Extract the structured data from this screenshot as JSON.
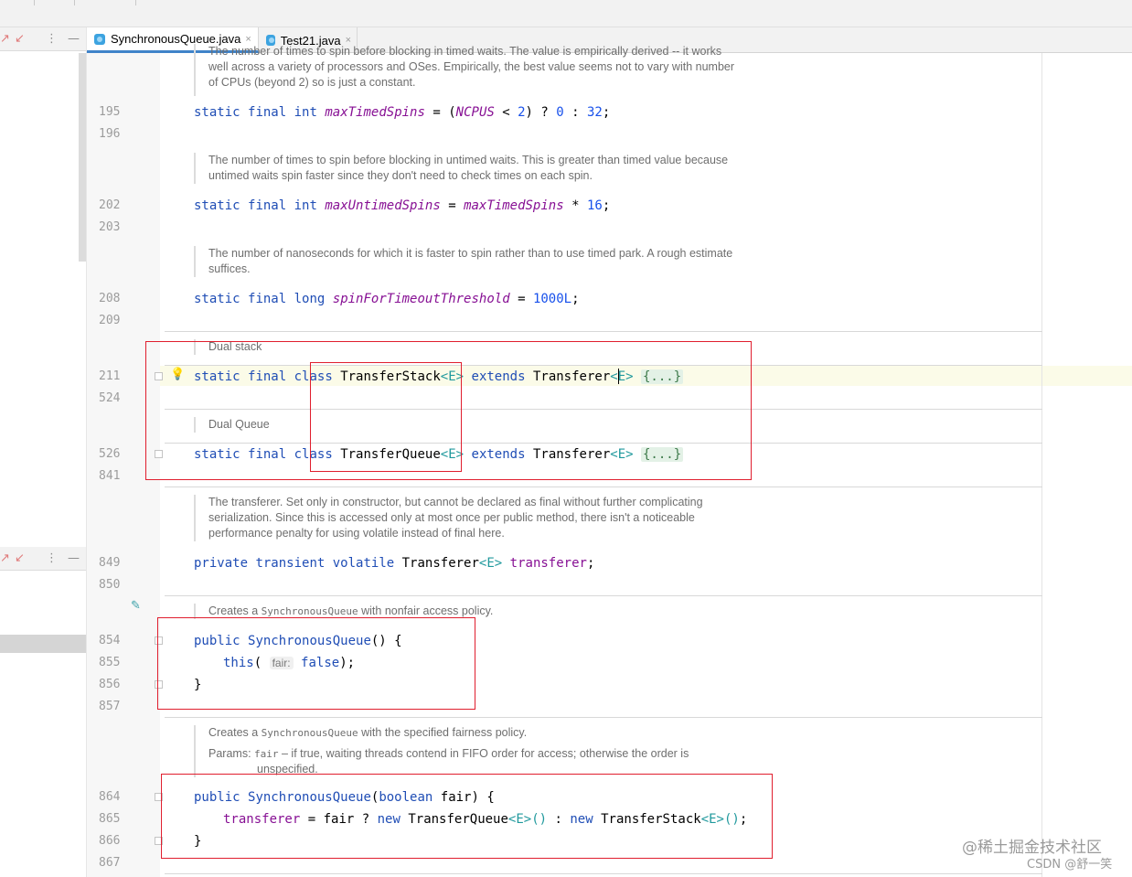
{
  "tabs": [
    {
      "label": "SynchronousQueue.java",
      "active": true
    },
    {
      "label": "Test21.java",
      "active": false
    }
  ],
  "close_glyph": "×",
  "left_panel_icons": [
    "↗",
    "↙",
    "⋮",
    "—"
  ],
  "line_numbers": [
    "195",
    "196",
    "202",
    "203",
    "208",
    "209",
    "211",
    "524",
    "526",
    "841",
    "849",
    "850",
    "854",
    "855",
    "856",
    "857",
    "864",
    "865",
    "866",
    "867"
  ],
  "docs": {
    "d1_line1": "The number of times to spin before blocking in timed waits. The value is empirically derived -- it works",
    "d1_line2": "well across a variety of processors and OSes. Empirically, the best value seems not to vary with number",
    "d1_line3": "of CPUs (beyond 2) so is just a constant.",
    "d2_line1": "The number of times to spin before blocking in untimed waits. This is greater than timed value because",
    "d2_line2": "untimed waits spin faster since they don't need to check times on each spin.",
    "d3_line1": "The number of nanoseconds for which it is faster to spin rather than to use timed park. A rough estimate",
    "d3_line2": "suffices.",
    "d4": "Dual stack",
    "d5": "Dual Queue",
    "d6_line1": "The transferer. Set only in constructor, but cannot be declared as final without further complicating",
    "d6_line2": "serialization. Since this is accessed only at most once per public method, there isn't a noticeable",
    "d6_line3": "performance penalty for using volatile instead of final here.",
    "d7_pre": "Creates a ",
    "d7_code": "SynchronousQueue",
    "d7_post": " with nonfair access policy.",
    "d8_pre": "Creates a ",
    "d8_code": "SynchronousQueue",
    "d8_post": " with the specified fairness policy.",
    "d8_params_label": "Params: ",
    "d8_params_code": "fair",
    "d8_params_text": " – if true, waiting threads contend in FIFO order for access; otherwise the order is",
    "d8_params_text2": "unspecified."
  },
  "code": {
    "static": "static",
    "final": "final",
    "int": "int",
    "long": "long",
    "class": "class",
    "extends": "extends",
    "private": "private",
    "transient": "transient",
    "volatile": "volatile",
    "public": "public",
    "boolean": "boolean",
    "new": "new",
    "this": "this",
    "false": "false",
    "maxTimedSpins": "maxTimedSpins",
    "maxUntimedSpins": "maxUntimedSpins",
    "spinForTimeoutThreshold": "spinForTimeoutThreshold",
    "NCPUS": "NCPUS",
    "n2": "2",
    "n0": "0",
    "n32": "32",
    "n16": "16",
    "n1000L": "1000L",
    "TransferStack": "TransferStack",
    "TransferQueue": "TransferQueue",
    "Transferer": "Transferer",
    "SynchronousQueue": "SynchronousQueue",
    "transferer": "transferer",
    "fair": "fair",
    "genE": "<E>",
    "genEparen": "<E>()",
    "fold": "{...}",
    "hint_fair": "fair:",
    "eq": " = ",
    "open_paren": "(",
    "lt": " < ",
    "close_q": ") ? ",
    "colon": " : ",
    "semi": ";",
    "times": " * ",
    "ctor_open": "() {",
    "close_brace": "}",
    "this_close": ");",
    "bool_close": ") {",
    "ternary_q": " ? ",
    "ternary_c": " : ",
    "ctor_end": ";",
    "space": " "
  },
  "watermark": {
    "line1": "@稀土掘金技术社区",
    "line2": "CSDN @舒一笑"
  },
  "colors": {
    "keyword": "#1f4db5",
    "field": "#871094",
    "number": "#1750eb",
    "generic": "#20999d",
    "annotation_box": "#e01e2e",
    "tab_accent": "#4083c9"
  }
}
